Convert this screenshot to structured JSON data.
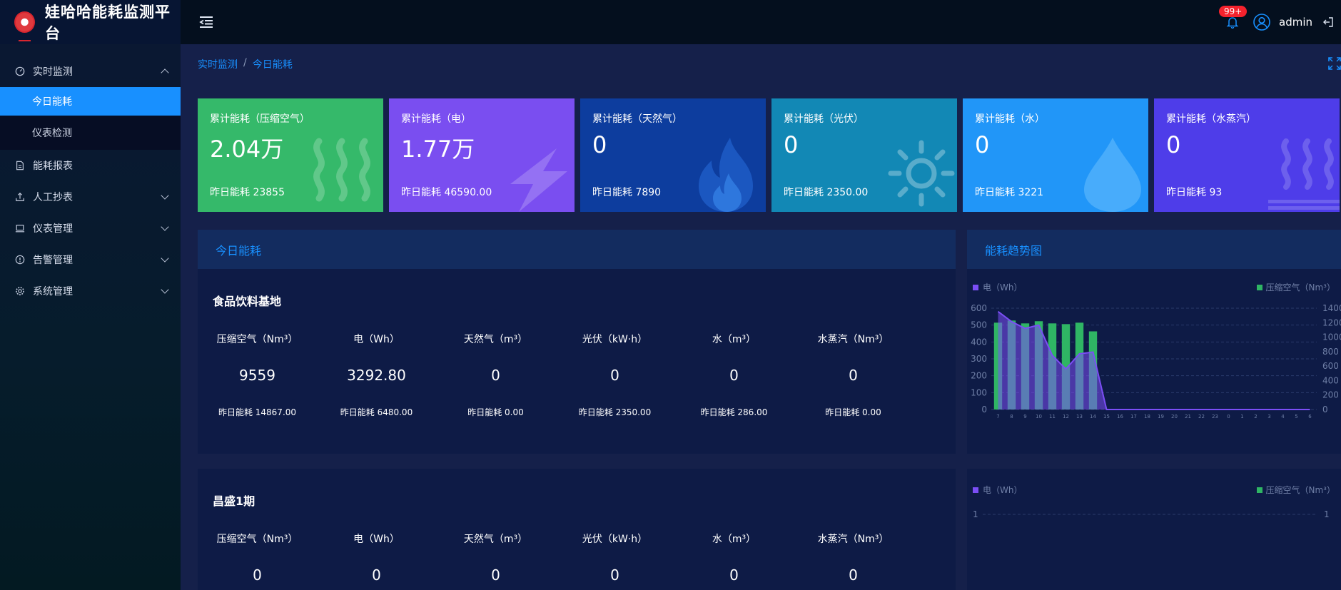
{
  "app": {
    "title": "娃哈哈能耗监测平台"
  },
  "sidebar": {
    "items": [
      {
        "label": "实时监测",
        "icon": "dashboard-icon",
        "expanded": true
      },
      {
        "label": "今日能耗",
        "sub": true,
        "active": true
      },
      {
        "label": "仪表检测",
        "sub": true
      },
      {
        "label": "能耗报表",
        "icon": "document-icon"
      },
      {
        "label": "人工抄表",
        "icon": "upload-icon",
        "expandable": true
      },
      {
        "label": "仪表管理",
        "icon": "laptop-icon",
        "expandable": true
      },
      {
        "label": "告警管理",
        "icon": "alert-circle-icon",
        "expandable": true
      },
      {
        "label": "系统管理",
        "icon": "gear-icon",
        "expandable": true
      }
    ]
  },
  "header": {
    "badge": "99+",
    "username": "admin"
  },
  "breadcrumb": {
    "parent": "实时监测",
    "separator": "/",
    "current": "今日能耗"
  },
  "cards": [
    {
      "label": "累计能耗（压缩空气）",
      "value": "2.04万",
      "yesterday": "昨日能耗 23855",
      "color": "#35b96a",
      "icon": "steam-icon"
    },
    {
      "label": "累计能耗（电）",
      "value": "1.77万",
      "yesterday": "昨日能耗 46590.00",
      "color": "#7a4ef0",
      "icon": "lightning-icon"
    },
    {
      "label": "累计能耗（天然气）",
      "value": "0",
      "yesterday": "昨日能耗 7890",
      "color": "#0d3d9e",
      "icon": "flame-icon"
    },
    {
      "label": "累计能耗（光伏）",
      "value": "0",
      "yesterday": "昨日能耗 2350.00",
      "color": "#1288b5",
      "icon": "sun-icon"
    },
    {
      "label": "累计能耗（水）",
      "value": "0",
      "yesterday": "昨日能耗 3221",
      "color": "#2196f8",
      "icon": "water-drop-icon"
    },
    {
      "label": "累计能耗（水蒸汽）",
      "value": "0",
      "yesterday": "昨日能耗 93",
      "color": "#4e3de9",
      "icon": "steam-icon"
    }
  ],
  "today_panel": {
    "title": "今日能耗"
  },
  "trend_panel": {
    "title": "能耗趋势图"
  },
  "sites": [
    {
      "name": "食品饮料基地",
      "metrics": [
        {
          "label": "压缩空气（Nm³）",
          "value": "9559",
          "yesterday": "昨日能耗 14867.00"
        },
        {
          "label": "电（Wh）",
          "value": "3292.80",
          "yesterday": "昨日能耗 6480.00"
        },
        {
          "label": "天然气（m³）",
          "value": "0",
          "yesterday": "昨日能耗 0.00"
        },
        {
          "label": "光伏（kW·h）",
          "value": "0",
          "yesterday": "昨日能耗 2350.00"
        },
        {
          "label": "水（m³）",
          "value": "0",
          "yesterday": "昨日能耗 286.00"
        },
        {
          "label": "水蒸汽（Nm³）",
          "value": "0",
          "yesterday": "昨日能耗 0.00"
        }
      ]
    },
    {
      "name": "昌盛1期",
      "metrics": [
        {
          "label": "压缩空气（Nm³）",
          "value": "0"
        },
        {
          "label": "电（Wh）",
          "value": "0"
        },
        {
          "label": "天然气（m³）",
          "value": "0"
        },
        {
          "label": "光伏（kW·h）",
          "value": "0"
        },
        {
          "label": "水（m³）",
          "value": "0"
        },
        {
          "label": "水蒸汽（Nm³）",
          "value": "0"
        }
      ]
    }
  ],
  "chart_data": [
    {
      "type": "bar",
      "legend_left": "电（Wh）",
      "legend_right": "压缩空气（Nm³）",
      "categories": [
        "7",
        "8",
        "9",
        "10",
        "11",
        "12",
        "13",
        "14",
        "15",
        "16",
        "17",
        "18",
        "19",
        "20",
        "21",
        "22",
        "23",
        "0",
        "1",
        "2",
        "3",
        "4",
        "5",
        "6"
      ],
      "series": [
        {
          "name": "电（Wh）",
          "type": "area",
          "axis": "left",
          "color": "#7b4ef5",
          "values": [
            580,
            520,
            480,
            500,
            320,
            240,
            330,
            340,
            0,
            0,
            0,
            0,
            0,
            0,
            0,
            0,
            0,
            0,
            0,
            0,
            0,
            0,
            0,
            0
          ]
        },
        {
          "name": "压缩空气（Nm³）",
          "type": "bar",
          "axis": "right",
          "color": "#2fb564",
          "values": [
            1200,
            1230,
            1190,
            1220,
            1190,
            1180,
            1200,
            1080,
            0,
            0,
            0,
            0,
            0,
            0,
            0,
            0,
            0,
            0,
            0,
            0,
            0,
            0,
            0,
            0
          ]
        }
      ],
      "yleft_ticks": [
        "0",
        "100",
        "200",
        "300",
        "400",
        "500",
        "600"
      ],
      "yright_ticks": [
        "0",
        "200",
        "400",
        "600",
        "800",
        "1000",
        "1200",
        "1400"
      ],
      "ylim_left": [
        0,
        600
      ],
      "ylim_right": [
        0,
        1400
      ],
      "grid": true
    },
    {
      "type": "bar",
      "legend_left": "电（Wh）",
      "legend_right": "压缩空气（Nm³）",
      "yleft_ticks": [
        "1"
      ],
      "yright_ticks": [
        "1"
      ],
      "series": []
    }
  ]
}
